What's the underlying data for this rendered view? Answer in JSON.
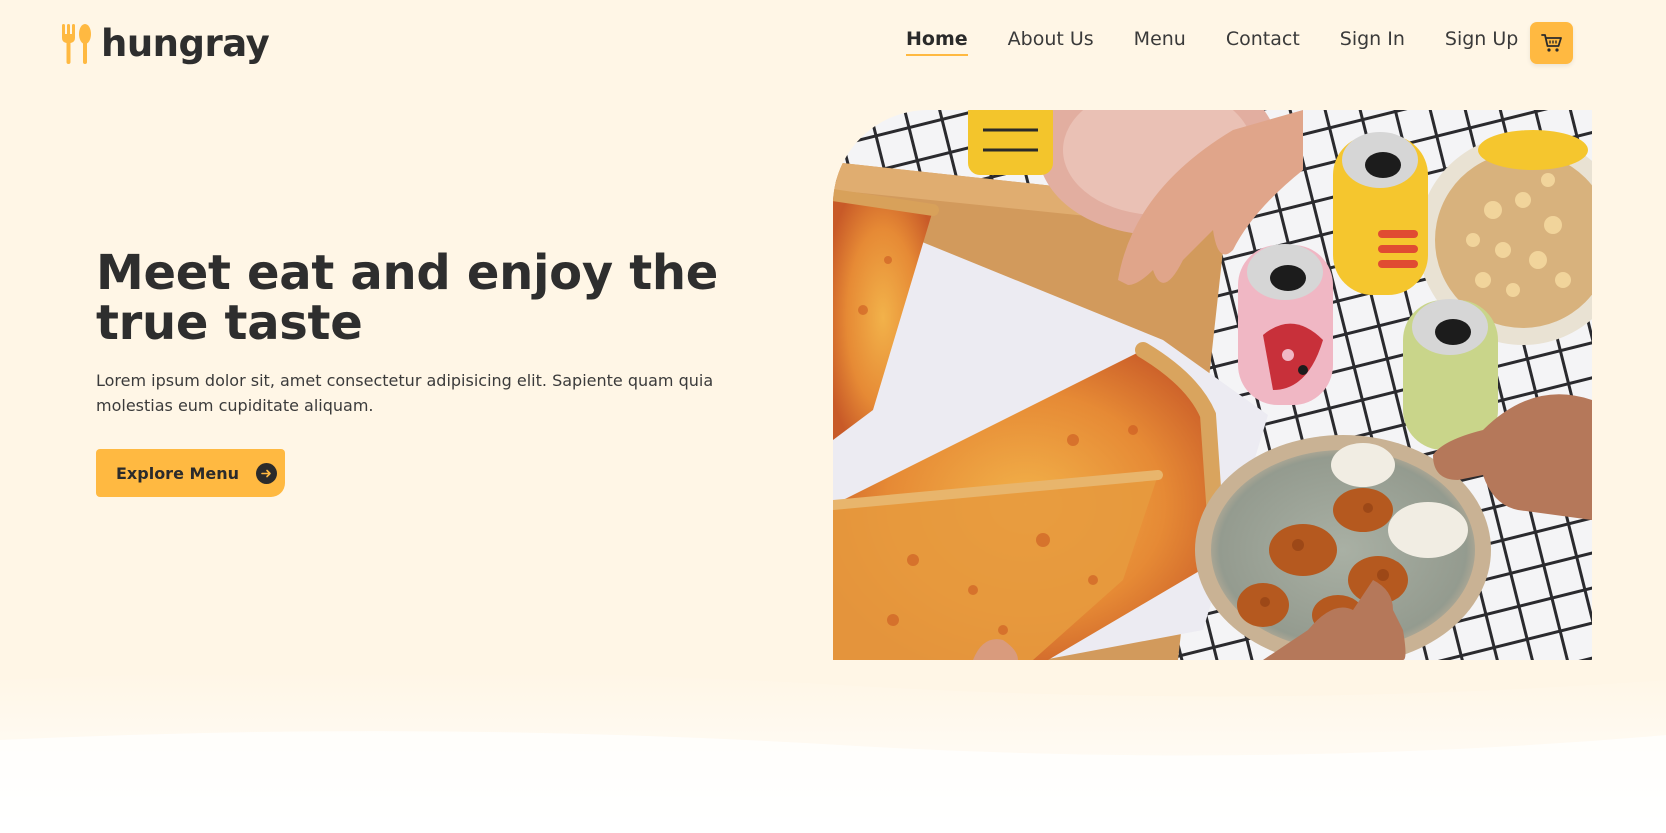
{
  "brand": {
    "name": "hungray",
    "accent": "#ffb941",
    "background": "#fff6e6",
    "text_color": "#2e2e2e",
    "logo_icon": "fork-spoon-icon"
  },
  "nav": {
    "items": [
      {
        "label": "Home",
        "active": true
      },
      {
        "label": "About Us",
        "active": false
      },
      {
        "label": "Menu",
        "active": false
      },
      {
        "label": "Contact",
        "active": false
      },
      {
        "label": "Sign In",
        "active": false
      },
      {
        "label": "Sign Up",
        "active": false
      }
    ],
    "cart_icon": "shopping-cart-icon"
  },
  "hero": {
    "title": "Meet eat and enjoy the true taste",
    "subtitle": "Lorem ipsum dolor sit, amet consectetur adipisicing elit. Sapiente quam quia molestias eum cupiditate aliquam.",
    "cta_label": "Explore Menu",
    "cta_icon": "arrow-right-circle-icon",
    "image_subject": "pizza-table-photo"
  }
}
